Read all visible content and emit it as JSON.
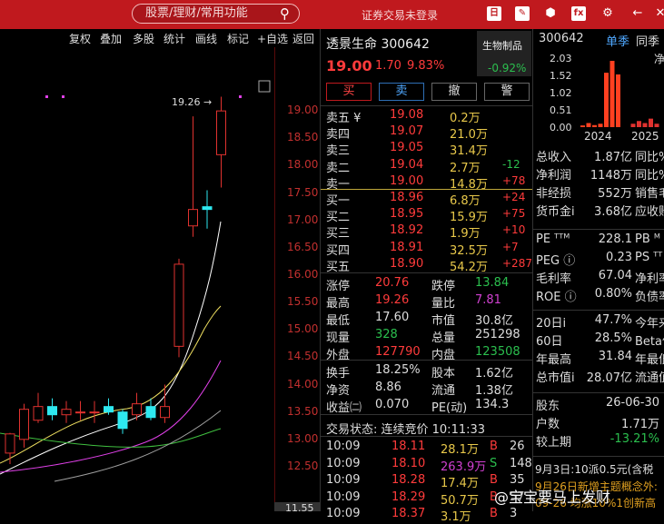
{
  "topbar": {
    "search_placeholder": "股票/理财/常用功能",
    "login_status": "证券交易未登录",
    "icons": [
      "f-box-icon",
      "edit-icon",
      "cube-icon",
      "formula-icon",
      "gear-icon",
      "back-icon",
      "close-icon"
    ],
    "accent": "#c0191e"
  },
  "chart_toolbar": [
    "复权",
    "叠加",
    "多股",
    "统计",
    "画线",
    "标记",
    "+自选",
    "返回"
  ],
  "chart_data": {
    "type": "candlestick",
    "y_ticks": [
      "19.00",
      "18.50",
      "18.00",
      "17.50",
      "17.00",
      "16.50",
      "16.00",
      "15.50",
      "15.00",
      "14.50",
      "14.00",
      "13.50",
      "13.00",
      "12.50"
    ],
    "ylim": [
      12.4,
      19.5
    ],
    "cursor_value": "11.55",
    "max_label": "19.26",
    "candles": [
      {
        "o": 12.75,
        "h": 13.12,
        "l": 12.55,
        "c": 13.1
      },
      {
        "o": 13.0,
        "h": 13.65,
        "l": 12.85,
        "c": 13.55
      },
      {
        "o": 13.35,
        "h": 13.85,
        "l": 13.3,
        "c": 13.6
      },
      {
        "o": 13.6,
        "h": 13.75,
        "l": 13.35,
        "c": 13.45
      },
      {
        "o": 13.45,
        "h": 13.7,
        "l": 13.3,
        "c": 13.55
      },
      {
        "o": 13.5,
        "h": 13.7,
        "l": 13.35,
        "c": 13.5
      },
      {
        "o": 13.5,
        "h": 13.7,
        "l": 13.3,
        "c": 13.5
      },
      {
        "o": 13.6,
        "h": 13.75,
        "l": 13.45,
        "c": 13.5
      },
      {
        "o": 13.5,
        "h": 13.55,
        "l": 13.1,
        "c": 13.2
      },
      {
        "o": 13.45,
        "h": 13.85,
        "l": 13.35,
        "c": 13.65
      },
      {
        "o": 13.6,
        "h": 13.75,
        "l": 13.35,
        "c": 13.4
      },
      {
        "o": 13.4,
        "h": 14.0,
        "l": 13.3,
        "c": 13.6
      },
      {
        "o": 14.7,
        "h": 16.3,
        "l": 14.5,
        "c": 16.2
      },
      {
        "o": 16.9,
        "h": 18.9,
        "l": 16.7,
        "c": 17.2
      },
      {
        "o": 17.25,
        "h": 17.55,
        "l": 16.85,
        "c": 17.2
      },
      {
        "o": 18.2,
        "h": 19.26,
        "l": 17.6,
        "c": 19.0
      }
    ],
    "colors": {
      "up": "#e0322f",
      "down": "#2ee8f0",
      "ma5": "#ffffff",
      "ma10": "#f0e060",
      "ma20": "#e040e8",
      "ma60": "#40c040",
      "ma30": "#a0a0a0"
    }
  },
  "quote": {
    "name_code": "透景生命 300642",
    "industry": "生物制品",
    "industry_change": "-0.92%",
    "price": "19.00",
    "change": "1.70",
    "change_pct": "9.83%",
    "buttons": [
      "买",
      "卖",
      "撤",
      "警"
    ],
    "sells": [
      {
        "label": "卖五 ¥",
        "price": "19.08",
        "vol": "0.2万",
        "delta": ""
      },
      {
        "label": "卖四",
        "price": "19.07",
        "vol": "21.0万",
        "delta": ""
      },
      {
        "label": "卖三",
        "price": "19.05",
        "vol": "31.4万",
        "delta": ""
      },
      {
        "label": "卖二",
        "price": "19.04",
        "vol": "2.7万",
        "delta": "-12"
      },
      {
        "label": "卖一",
        "price": "19.00",
        "vol": "14.8万",
        "delta": "+78"
      }
    ],
    "buys": [
      {
        "label": "买一",
        "price": "18.96",
        "vol": "6.8万",
        "delta": "+24"
      },
      {
        "label": "买二",
        "price": "18.95",
        "vol": "15.9万",
        "delta": "+75"
      },
      {
        "label": "买三",
        "price": "18.92",
        "vol": "1.9万",
        "delta": "+10"
      },
      {
        "label": "买四",
        "price": "18.91",
        "vol": "32.5万",
        "delta": "+7"
      },
      {
        "label": "买五",
        "price": "18.90",
        "vol": "54.2万",
        "delta": "+287"
      }
    ],
    "stats": [
      {
        "k1": "涨停",
        "v1": "20.76",
        "k2": "跌停",
        "v2": "13.84"
      },
      {
        "k1": "最高",
        "v1": "19.26",
        "k2": "量比",
        "v2": "7.81"
      },
      {
        "k1": "最低",
        "v1": "17.60",
        "k2": "市值",
        "v2": "30.8亿"
      },
      {
        "k1": "现量",
        "v1": "328",
        "k2": "总量",
        "v2": "251298"
      },
      {
        "k1": "外盘",
        "v1": "127790",
        "k2": "内盘",
        "v2": "123508"
      }
    ],
    "stats2": [
      {
        "k1": "换手",
        "v1": "18.25%",
        "k2": "股本",
        "v2": "1.62亿"
      },
      {
        "k1": "净资",
        "v1": "8.86",
        "k2": "流通",
        "v2": "1.38亿"
      },
      {
        "k1": "收益㈡",
        "v1": "0.070",
        "k2": "PE(动)",
        "v2": "134.3"
      }
    ],
    "trade_status": "交易状态: 连续竞价 10:11:33",
    "ticks": [
      {
        "t": "10:09",
        "p": "18.11",
        "v": "28.1万",
        "s": "B",
        "n": "26"
      },
      {
        "t": "10:09",
        "p": "18.10",
        "v": "263.9万",
        "s": "S",
        "n": "148"
      },
      {
        "t": "10:09",
        "p": "18.28",
        "v": "17.4万",
        "s": "B",
        "n": "35"
      },
      {
        "t": "10:09",
        "p": "18.29",
        "v": "50.7万",
        "s": "B",
        "n": "57"
      },
      {
        "t": "10:09",
        "p": "18.37",
        "v": "3.1万",
        "s": "B",
        "n": "3"
      }
    ]
  },
  "info": {
    "code": "300642",
    "tab1": "单季",
    "tab2": "同季",
    "net_label": "净",
    "bar_yticks": [
      "2.03",
      "1.52",
      "1.02",
      "0.51",
      "0.00"
    ],
    "bar_years": [
      "2024",
      "2025"
    ],
    "bar_values": [
      0.05,
      0.12,
      0.06,
      0.1,
      1.6,
      1.95,
      1.55,
      0.1,
      0.18,
      0.12,
      0.25,
      0.1
    ],
    "rows1": [
      {
        "k": "总收入",
        "v": "1.87亿",
        "e": "同比%"
      },
      {
        "k": "净利润",
        "v": "1148万",
        "e": "同比%"
      },
      {
        "k": "非经损",
        "v": "552万",
        "e": "销售毛"
      },
      {
        "k": "货币金i",
        "v": "3.68亿",
        "e": "应收账"
      }
    ],
    "rows2": [
      {
        "k": "PE ᵀᵀᴹ",
        "v": "228.1",
        "e": "PB ᴹ"
      },
      {
        "k": "PEG ⓘ",
        "v": "0.23",
        "e": "PS ᵀᵀ"
      },
      {
        "k": "毛利率",
        "v": "67.04",
        "e": "净利率"
      },
      {
        "k": "ROE ⓘ",
        "v": "0.80%",
        "e": "负债率"
      }
    ],
    "rows3": [
      {
        "k": "20日i",
        "v": "47.7%",
        "e": "今年来"
      },
      {
        "k": "60日",
        "v": "28.5%",
        "e": "Beta值"
      },
      {
        "k": "年最高",
        "v": "31.84",
        "e": "年最低"
      },
      {
        "k": "总市值i",
        "v": "28.07亿",
        "e": "流通值"
      }
    ],
    "rows4": [
      {
        "k": "股东",
        "v": "26-06-30"
      },
      {
        "k": "户数",
        "v": "1.71万"
      },
      {
        "k": "较上期",
        "v": "-13.21%"
      }
    ],
    "dividend": "9月3日:10派0.5元(含税",
    "news": "9月26日新增主题概念外:",
    "news2": "09-26 均涨10%1创新高"
  },
  "watermark": "@宝宝要马上发财"
}
